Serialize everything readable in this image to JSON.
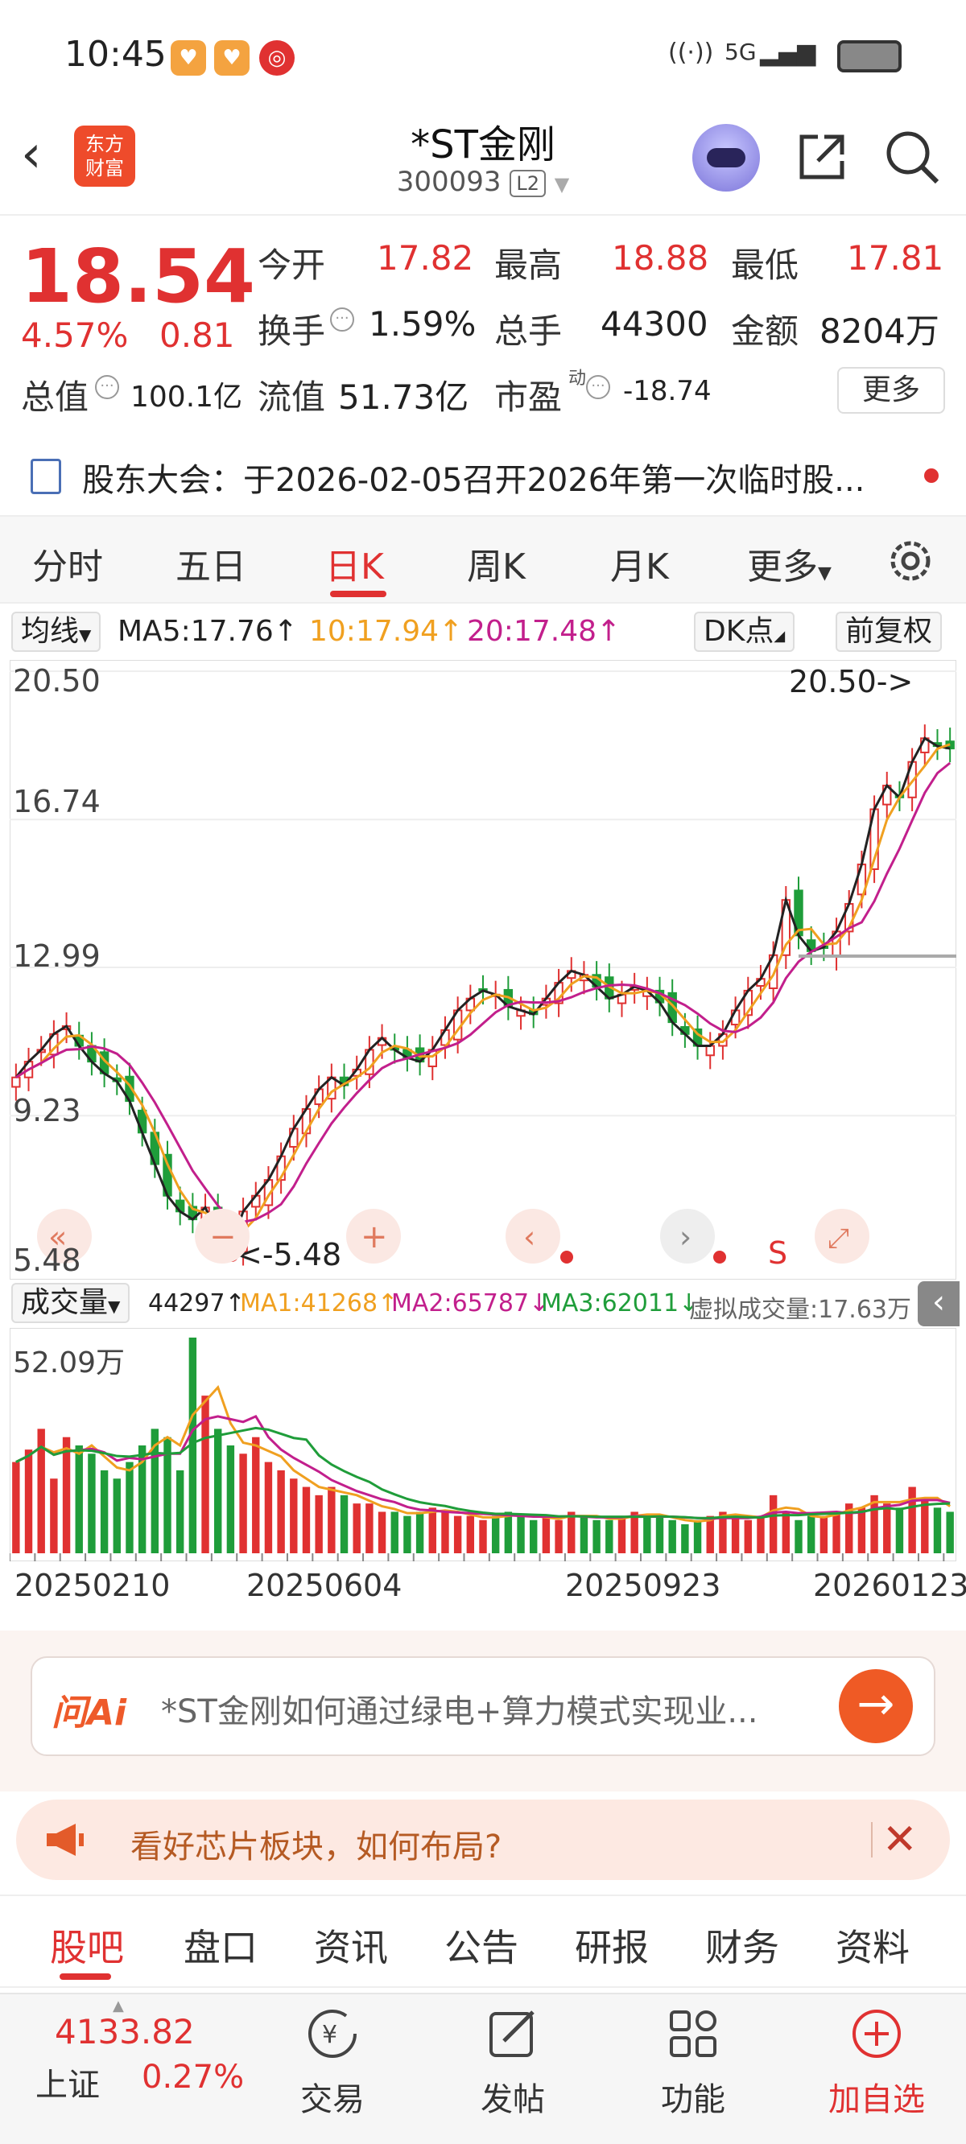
{
  "status_bar": {
    "time": "10:45",
    "network": "5G"
  },
  "header": {
    "logo_text_1": "东方",
    "logo_text_2": "财富",
    "stock_name": "*ST金刚",
    "stock_code": "300093",
    "level": "L2"
  },
  "quote": {
    "price": "18.54",
    "change_pct": "4.57%",
    "change": "0.81",
    "open_label": "今开",
    "open": "17.82",
    "high_label": "最高",
    "high": "18.88",
    "low_label": "最低",
    "low": "17.81",
    "turnover_label": "换手",
    "turnover": "1.59%",
    "volume_label": "总手",
    "volume": "44300",
    "amount_label": "金额",
    "amount": "8204万",
    "mktcap_label": "总值",
    "mktcap": "100.1亿",
    "float_label": "流值",
    "float_cap": "51.73亿",
    "pe_label": "市盈",
    "pe_sup": "动",
    "pe": "-18.74",
    "more": "更多"
  },
  "notice": {
    "text": "股东大会：于2026-02-05召开2026年第一次临时股..."
  },
  "period_tabs": [
    "分时",
    "五日",
    "日K",
    "周K",
    "月K",
    "更多"
  ],
  "active_period": "日K",
  "ma_bar": {
    "select": "均线",
    "ma5": "MA5:17.76↑",
    "ma10": "10:17.94↑",
    "ma20": "20:17.48↑",
    "dk": "DK点",
    "adjust": "前复权"
  },
  "colors": {
    "up": "#e03131",
    "down": "#1f9d3a",
    "ma5": "#222222",
    "ma10": "#f0a020",
    "ma20": "#c21f8c"
  },
  "chart_data": [
    {
      "type": "candlestick",
      "y_ticks": [
        "20.50",
        "16.74",
        "12.99",
        "9.23",
        "5.48"
      ],
      "ylim": [
        5.48,
        20.5
      ],
      "max_label": "20.50->",
      "min_label": "<-5.48",
      "ma5": [
        10.2,
        10.6,
        10.9,
        11.3,
        11.5,
        11.0,
        10.6,
        10.3,
        10.1,
        9.6,
        8.8,
        8.0,
        7.2,
        6.8,
        6.6,
        6.9,
        6.2,
        5.9,
        6.8,
        7.2,
        7.6,
        8.2,
        8.9,
        9.4,
        9.9,
        10.2,
        10.0,
        10.4,
        10.9,
        11.2,
        10.9,
        10.7,
        10.6,
        10.9,
        11.4,
        11.9,
        12.2,
        12.4,
        12.3,
        12.0,
        11.9,
        11.8,
        12.2,
        12.6,
        12.9,
        12.8,
        12.5,
        12.2,
        12.3,
        12.5,
        12.4,
        12.1,
        11.6,
        11.3,
        11.0,
        11.0,
        11.3,
        11.9,
        12.4,
        12.7,
        13.3,
        14.7,
        13.8,
        13.4,
        13.5,
        13.9,
        14.6,
        15.6,
        17.0,
        17.6,
        17.3,
        18.2,
        18.8,
        18.6,
        18.54
      ]
    },
    {
      "type": "bar",
      "name": "成交量",
      "y_ticks": [
        "52.09万"
      ],
      "x_ticks": [
        "20250210",
        "20250604",
        "20250923",
        "20260123"
      ],
      "values": [
        22,
        25,
        30,
        18,
        28,
        26,
        24,
        20,
        18,
        22,
        26,
        30,
        28,
        20,
        52,
        38,
        30,
        26,
        24,
        28,
        22,
        20,
        18,
        16,
        14,
        16,
        14,
        12,
        12,
        10,
        10,
        9,
        10,
        11,
        10,
        9,
        9,
        8,
        9,
        10,
        9,
        8,
        9,
        8,
        10,
        9,
        8,
        8,
        9,
        10,
        9,
        9,
        8,
        7,
        8,
        9,
        10,
        9,
        8,
        9,
        14,
        10,
        8,
        9,
        9,
        10,
        12,
        11,
        14,
        12,
        11,
        16,
        13,
        11,
        10
      ]
    }
  ],
  "vol_bar": {
    "select": "成交量",
    "vol": "44297↑",
    "ma1": "MA1:41268↑",
    "ma2": "MA2:65787↓",
    "ma3": "MA3:62011↓",
    "virtual": "虚拟成交量:17.63万"
  },
  "ai": {
    "logo": "问Ai",
    "prompt": "*ST金刚如何通过绿电+算力模式实现业..."
  },
  "promo": {
    "text": "看好芯片板块，如何布局?"
  },
  "bottom_tabs": [
    "股吧",
    "盘口",
    "资讯",
    "公告",
    "研报",
    "财务",
    "资料"
  ],
  "navbar": {
    "index_value": "4133.82",
    "index_name": "上证",
    "index_pct": "0.27%",
    "items": [
      "交易",
      "发帖",
      "功能",
      "加自选"
    ]
  }
}
